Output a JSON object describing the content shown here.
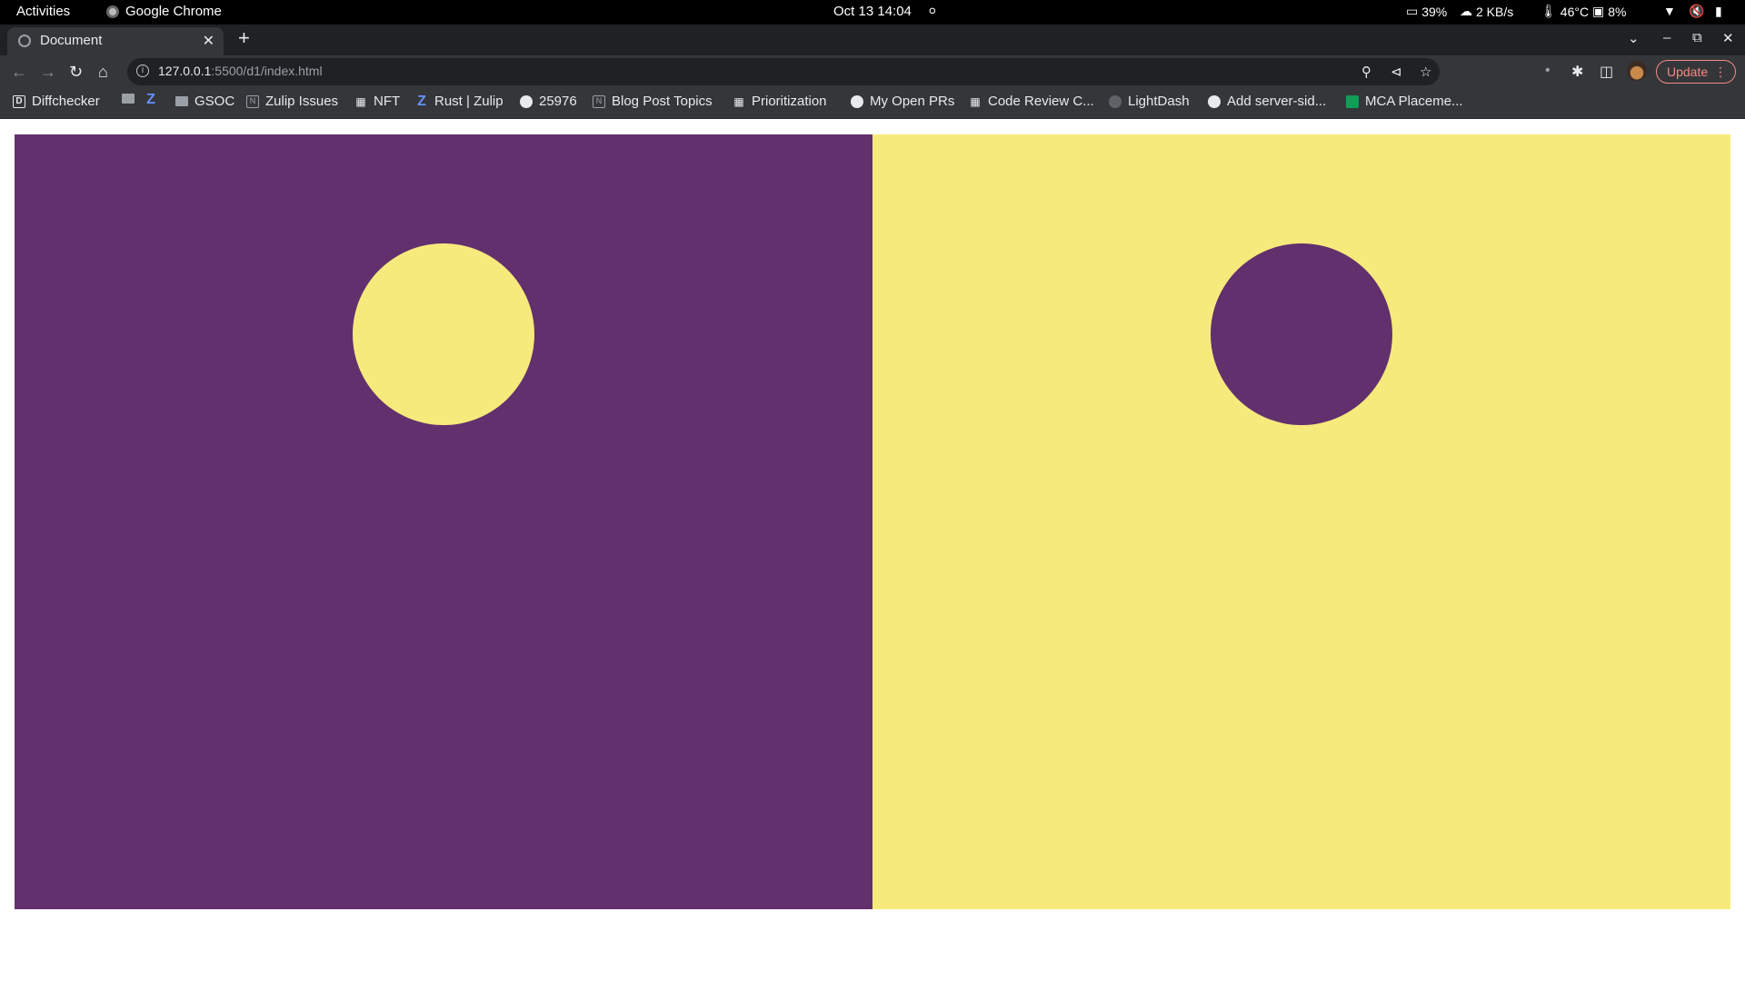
{
  "system_bar": {
    "activities": "Activities",
    "app_name": "Google Chrome",
    "datetime": "Oct 13  14:04",
    "battery": "39%",
    "network": "2 KB/s",
    "temperature": "46°C",
    "cpu": "8%"
  },
  "tab": {
    "title": "Document"
  },
  "address_bar": {
    "host": "127.0.0.1",
    "rest": ":5500/d1/index.html"
  },
  "toolbar": {
    "update_label": "Update"
  },
  "bookmarks": [
    {
      "label": "Diffchecker",
      "icon": "diffchecker-icon"
    },
    {
      "label": "",
      "icon": "folder-icon"
    },
    {
      "label": "",
      "icon": "zulip-icon"
    },
    {
      "label": "GSOC",
      "icon": "folder-icon"
    },
    {
      "label": "Zulip Issues",
      "icon": "notion-icon"
    },
    {
      "label": "NFT",
      "icon": "sheet-icon"
    },
    {
      "label": "Rust | Zulip",
      "icon": "zulip-icon"
    },
    {
      "label": "25976",
      "icon": "github-icon"
    },
    {
      "label": "Blog Post Topics",
      "icon": "notion-icon"
    },
    {
      "label": "Prioritization",
      "icon": "sheet-icon"
    },
    {
      "label": "My Open PRs",
      "icon": "github-icon"
    },
    {
      "label": "Code Review C...",
      "icon": "sheet-icon"
    },
    {
      "label": "LightDash",
      "icon": "github-icon"
    },
    {
      "label": "Add server-sid...",
      "icon": "github-icon"
    },
    {
      "label": "MCA Placeme...",
      "icon": "google-sheets-icon"
    }
  ],
  "page": {
    "left_panel_color": "#62306d",
    "left_circle_color": "#f7ea7c",
    "right_panel_color": "#f7ea7c",
    "right_circle_color": "#62306d"
  }
}
